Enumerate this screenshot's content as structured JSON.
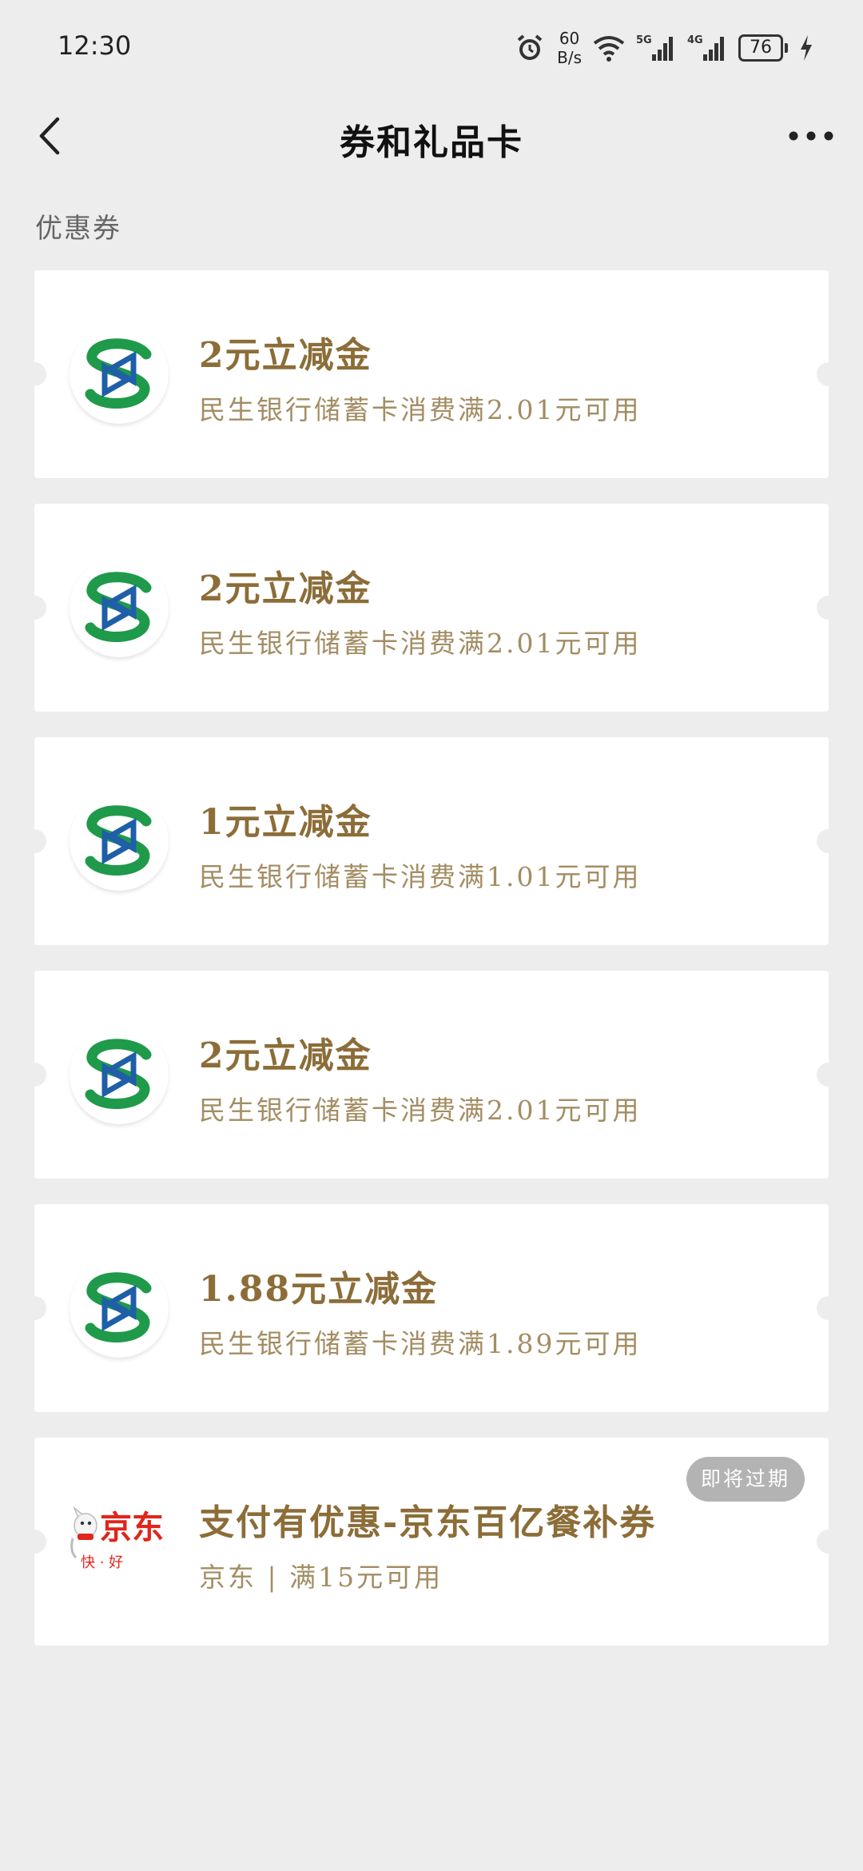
{
  "status_bar": {
    "time": "12:30",
    "net_speed_value": "60",
    "net_speed_unit": "B/s",
    "battery": "76"
  },
  "nav": {
    "title": "券和礼品卡"
  },
  "section": {
    "label": "优惠券"
  },
  "coupons": [
    {
      "title": "2元立减金",
      "desc": "民生银行储蓄卡消费满2.01元可用",
      "logo": "bank-logo"
    },
    {
      "title": "2元立减金",
      "desc": "民生银行储蓄卡消费满2.01元可用",
      "logo": "bank-logo"
    },
    {
      "title": "1元立减金",
      "desc": "民生银行储蓄卡消费满1.01元可用",
      "logo": "bank-logo"
    },
    {
      "title": "2元立减金",
      "desc": "民生银行储蓄卡消费满2.01元可用",
      "logo": "bank-logo"
    },
    {
      "title": "1.88元立减金",
      "desc": "民生银行储蓄卡消费满1.89元可用",
      "logo": "bank-logo"
    },
    {
      "title": "支付有优惠-京东百亿餐补券",
      "desc": "京东 | 满15元可用",
      "logo": "jd-logo",
      "badge": "即将过期",
      "logo_text_main": "京东",
      "logo_text_sub": "快 · 好"
    }
  ],
  "colors": {
    "background": "#ededed",
    "card": "#ffffff",
    "coupon_title": "#8c6d38",
    "coupon_desc": "#a38d63",
    "badge_bg": "#b3b3b3",
    "bank_green": "#1f9a4a",
    "bank_blue": "#1f5fa8",
    "jd_red": "#e1251b"
  }
}
